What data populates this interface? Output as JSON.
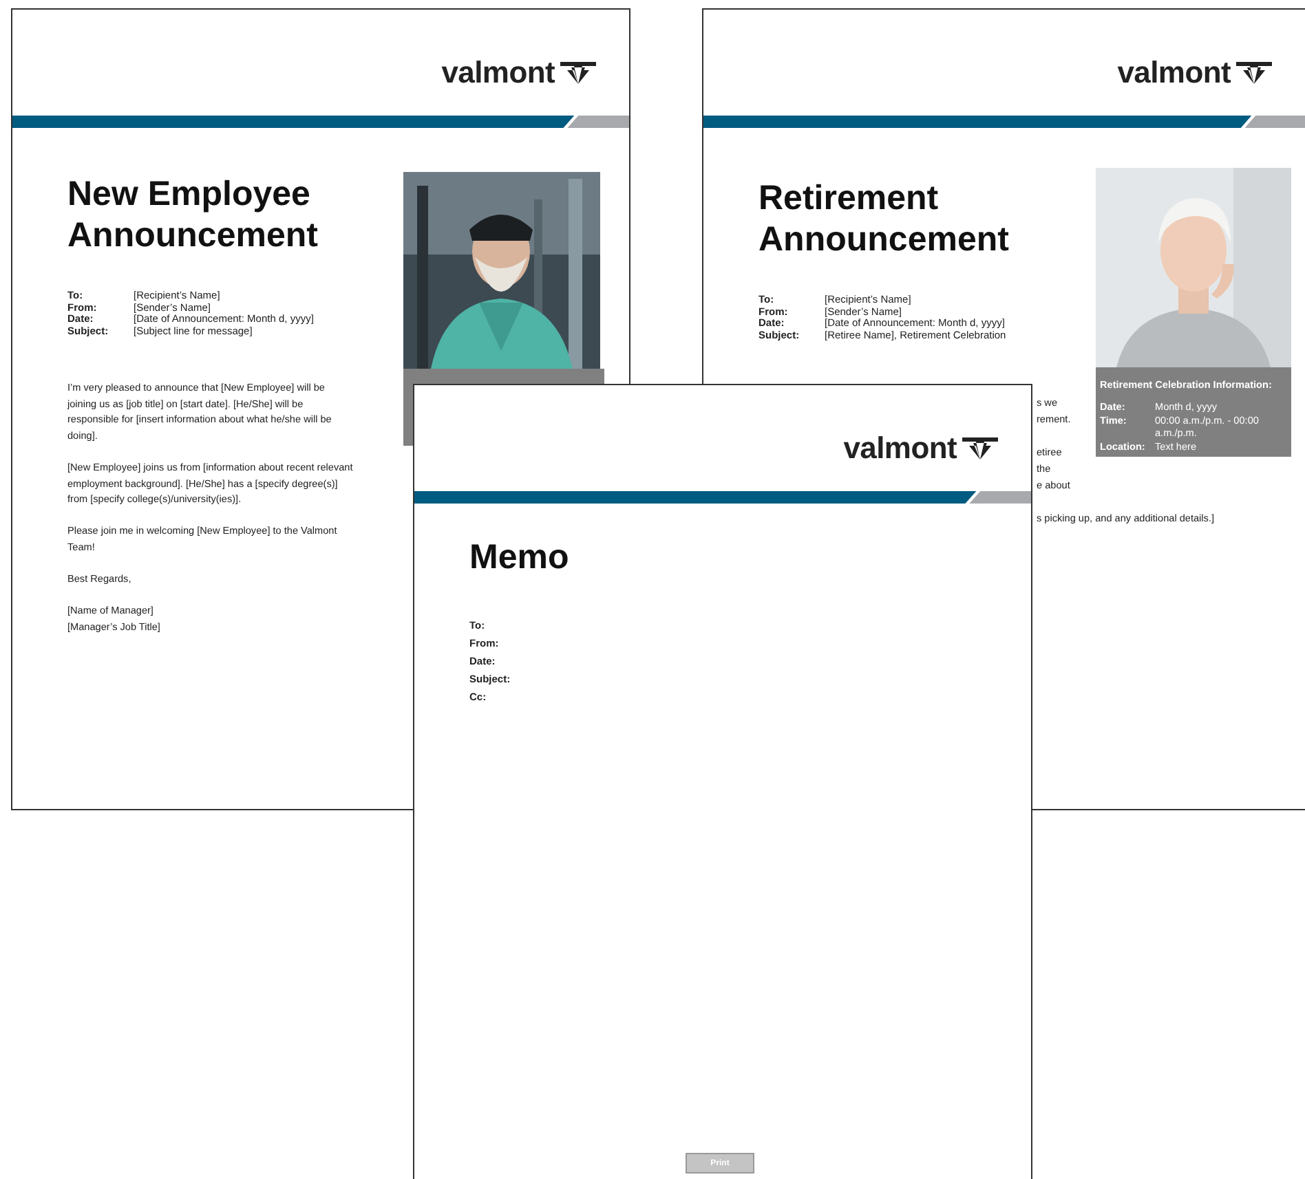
{
  "pages": [
    {
      "kind": "announcement",
      "logo": "valmont",
      "title": "New Employee Announcement",
      "photo": {
        "kind": "picture"
      },
      "fields": [
        {
          "label": "To:",
          "value": "[Recipient’s Name]"
        },
        {
          "label": "From:",
          "value": "[Sender’s Name]"
        },
        {
          "label": "Date:",
          "value": "[Date of Announcement: Month d, yyyy]"
        },
        {
          "label": "Subject:",
          "value": "[Subject line for message]"
        }
      ],
      "body": [
        "I’m very pleased to announce that [New Employee] will be joining us as [job title] on [start date]. [He/She] will be responsible for [insert information about what he/she will be doing].",
        "[New Employee] joins us from [information about recent relevant employment background]. [He/She] has a [specify degree(s)] from [specify college(s)/university(ies)].",
        "Please join me in welcoming [New Employee] to the Valmont Team!",
        "Best Regards,",
        "[Name of Manager]\n[Manager’s Job Title]"
      ]
    },
    {
      "kind": "retirement",
      "logo": "valmont",
      "title": "Retirement Announcement",
      "photo": {
        "kind": "picture"
      },
      "fields": [
        {
          "label": "To:",
          "value": "[Recipient’s Name]"
        },
        {
          "label": "From:",
          "value": "[Sender’s Name]"
        },
        {
          "label": "Date:",
          "value": "[Date of Announcement: Month d, yyyy]"
        },
        {
          "label": "Subject:",
          "value": "[Retiree Name], Retirement Celebration"
        }
      ],
      "celebration": {
        "heading": "Retirement Celebration Information:",
        "rows": [
          {
            "label": "Date:",
            "value": "Month d, yyyy"
          },
          {
            "label": "Time:",
            "value": "00:00 a.m./p.m. - 00:00 a.m./p.m."
          },
          {
            "label": "Location:",
            "value": "Text here"
          }
        ]
      },
      "body_fragments": [
        "s we",
        "rement.",
        "etiree",
        "the",
        "e about",
        "s picking up, and any additional details.]"
      ]
    },
    {
      "kind": "memo",
      "logo": "valmont",
      "title": "Memo",
      "fields": [
        {
          "label": "To:"
        },
        {
          "label": "From:"
        },
        {
          "label": "Date:"
        },
        {
          "label": "Subject:"
        },
        {
          "label": "Cc:"
        }
      ],
      "print_button": "Print"
    }
  ]
}
